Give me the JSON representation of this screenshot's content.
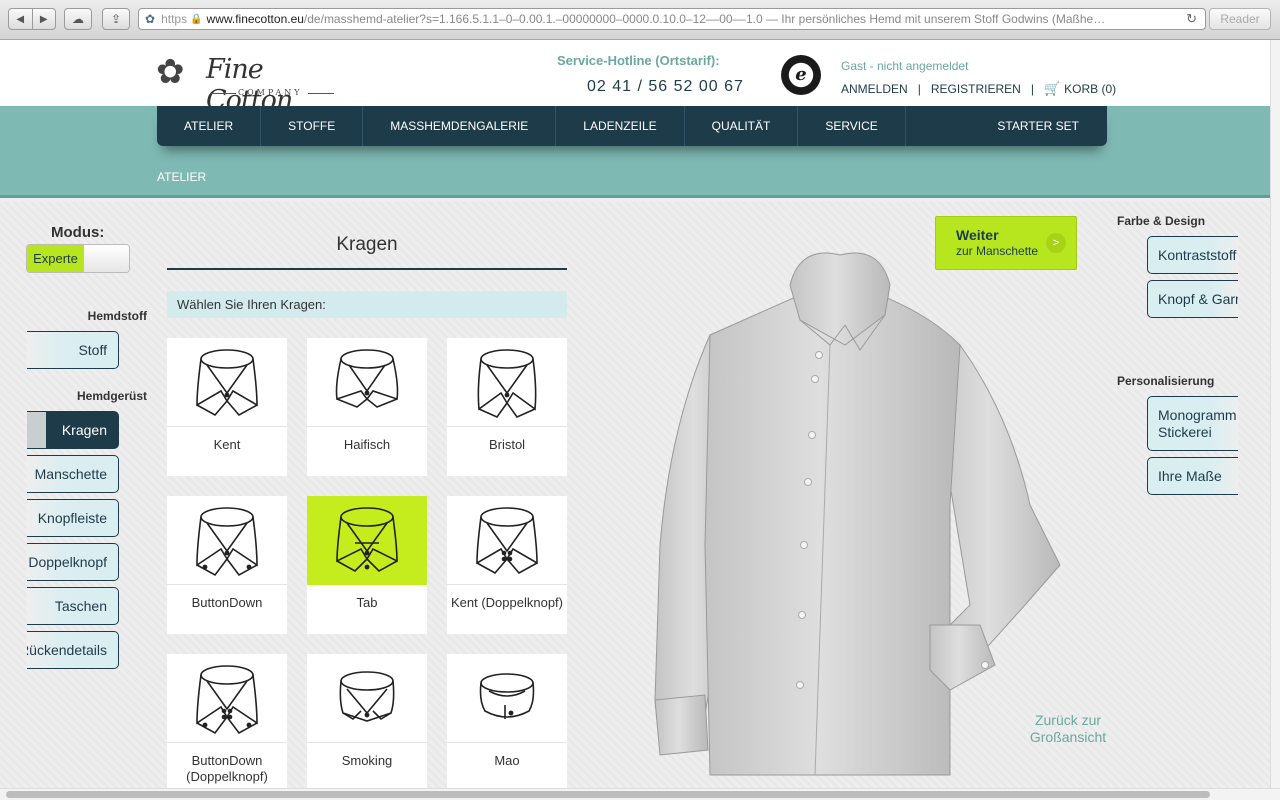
{
  "browser": {
    "protocol": "https",
    "domain": "www.finecotton.eu",
    "path": "/de/masshemd-atelier?s=1.166.5.1.1–0–0.00.1.–00000000–0000.0.10.0–12––00––1.0 — Ihr persönliches Hemd mit unserem Stoff Godwins (Maßhe…",
    "reader_label": "Reader"
  },
  "header": {
    "logo_text": "Fine Cotton",
    "logo_sub": "COMPANY",
    "hotline_label": "Service-Hotline (Ortstarif):",
    "hotline_number": "02 41 / 56 52 00 67",
    "trust_mark": "e",
    "guest_text": "Gast - nicht angemeldet",
    "login": "ANMELDEN",
    "register": "REGISTRIEREN",
    "sep": "|",
    "cart": "KORB (0)"
  },
  "nav": {
    "items": [
      "ATELIER",
      "STOFFE",
      "MASSHEMDENGALERIE",
      "LADENZEILE",
      "QUALITÄT",
      "SERVICE"
    ],
    "starter": "STARTER SET"
  },
  "breadcrumb": "ATELIER",
  "left": {
    "modus_label": "Modus:",
    "modus_value": "Experte",
    "hemdstoff_label": "Hemdstoff",
    "stoff": "Stoff",
    "hemdgeruest_label": "Hemdgerüst",
    "buttons": [
      "Kragen",
      "Manschette",
      "Knopfleiste",
      "Doppelknopf",
      "Taschen",
      "Rückendetails"
    ]
  },
  "panel": {
    "title": "Kragen",
    "instruction": "Wählen Sie Ihren Kragen:",
    "collars": [
      "Kent",
      "Haifisch",
      "Bristol",
      "ButtonDown",
      "Tab",
      "Kent (Doppelknopf)",
      "ButtonDown (Doppelknopf)",
      "Smoking",
      "Mao"
    ],
    "selected": "Tab"
  },
  "weiter": {
    "title": "Weiter",
    "sub": "zur Manschette",
    "arrow": ">"
  },
  "back_link": "Zurück zur Großansicht",
  "right": {
    "farbe_label": "Farbe & Design",
    "kontrast": "Kontraststoff",
    "knopf": "Knopf & Garn",
    "person_label": "Personalisierung",
    "monogramm": "Monogramm Stickerei",
    "masse": "Ihre Maße"
  },
  "colors": {
    "navy": "#1e3b4a",
    "teal": "#7fb9b3",
    "lime": "#b7e61e",
    "light_teal": "#d4ebee"
  }
}
